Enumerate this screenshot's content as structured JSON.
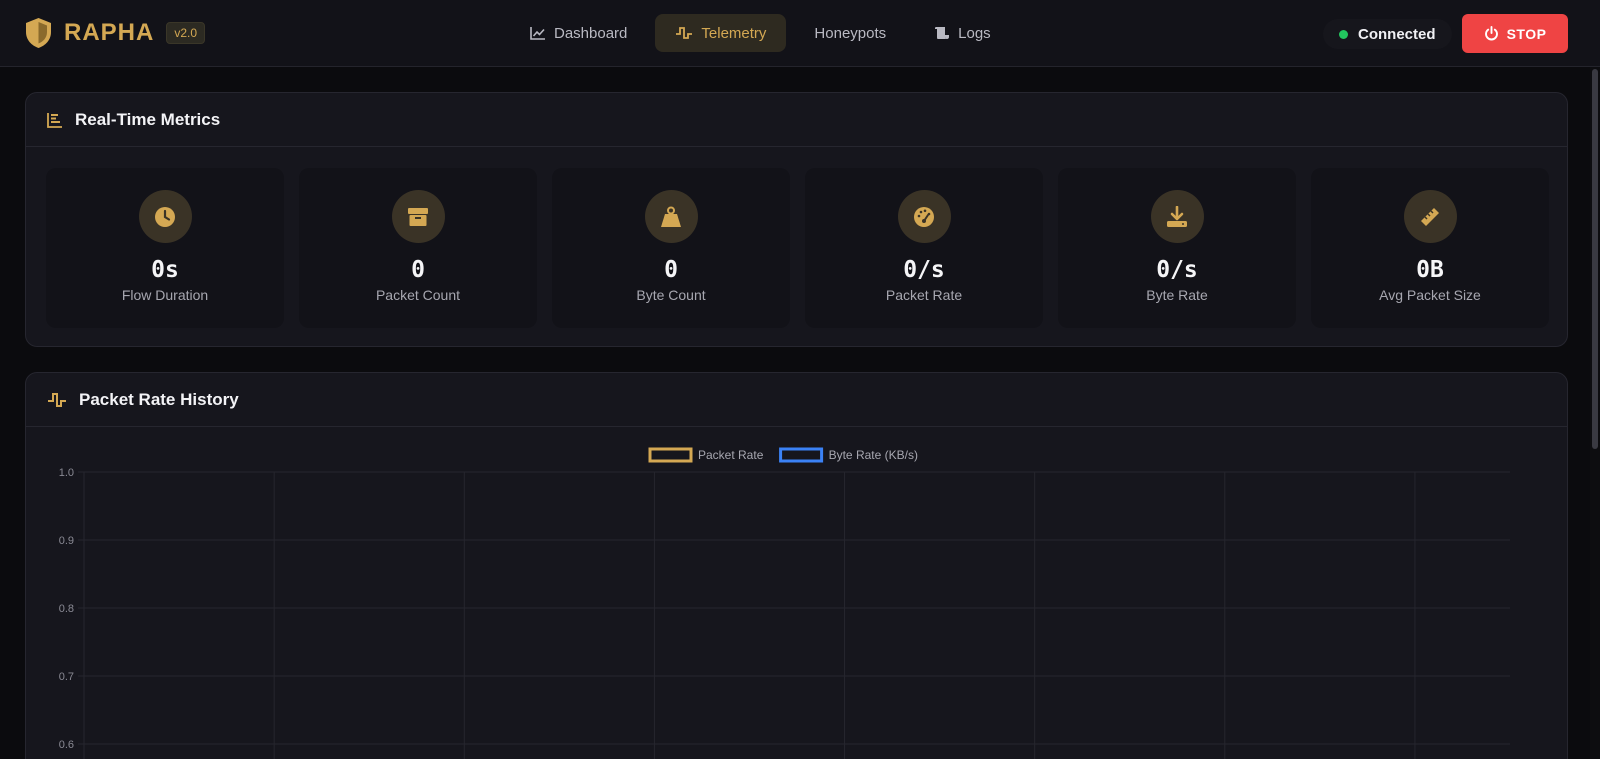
{
  "brand": {
    "name": "RAPHA",
    "version": "v2.0"
  },
  "nav": [
    {
      "label": "Dashboard",
      "icon": "chart-line-icon",
      "active": false
    },
    {
      "label": "Telemetry",
      "icon": "pulse-icon",
      "active": true
    },
    {
      "label": "Honeypots",
      "icon": "",
      "active": false
    },
    {
      "label": "Logs",
      "icon": "scroll-icon",
      "active": false
    }
  ],
  "status": {
    "label": "Connected",
    "color": "#22c55e"
  },
  "stop_label": "STOP",
  "metrics": {
    "title": "Real-Time Metrics",
    "items": [
      {
        "value": "0s",
        "label": "Flow Duration",
        "icon": "clock-icon"
      },
      {
        "value": "0",
        "label": "Packet Count",
        "icon": "box-icon"
      },
      {
        "value": "0",
        "label": "Byte Count",
        "icon": "weight-icon"
      },
      {
        "value": "0/s",
        "label": "Packet Rate",
        "icon": "gauge-icon"
      },
      {
        "value": "0/s",
        "label": "Byte Rate",
        "icon": "download-icon"
      },
      {
        "value": "0B",
        "label": "Avg Packet Size",
        "icon": "ruler-icon"
      }
    ]
  },
  "history": {
    "title": "Packet Rate History"
  },
  "chart_data": {
    "type": "line",
    "series": [
      {
        "name": "Packet Rate",
        "color": "#d4a853",
        "values": []
      },
      {
        "name": "Byte Rate (KB/s)",
        "color": "#3b82f6",
        "values": []
      }
    ],
    "y_ticks": [
      "1.0",
      "0.9",
      "0.8",
      "0.7",
      "0.6"
    ],
    "ylim": [
      0.6,
      1.0
    ],
    "x_grid_lines": 8,
    "legend": "top-center",
    "grid": true
  },
  "colors": {
    "accent": "#d4a853",
    "danger": "#ef4444",
    "panel": "#16161d"
  }
}
